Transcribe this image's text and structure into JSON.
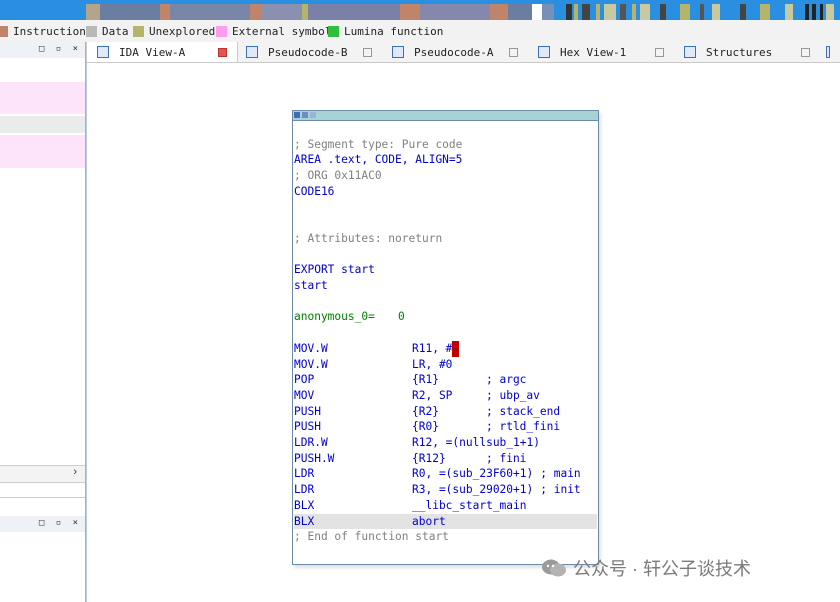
{
  "legend": {
    "items": [
      {
        "label": "Instruction",
        "color": "#c0846a"
      },
      {
        "label": "Data",
        "color": "#b9b9b9"
      },
      {
        "label": "Unexplored",
        "color": "#b4b46a"
      },
      {
        "label": "External symbol",
        "color": "#ff9cf0"
      },
      {
        "label": "Lumina function",
        "color": "#2fbf3a"
      }
    ]
  },
  "left_panel": {
    "header_buttons": "□ ▫ ×",
    "scroll_arrow": "›",
    "second_header_buttons": "□ ▫ ×"
  },
  "tabs": [
    {
      "label": "IDA View-A",
      "active": true
    },
    {
      "label": "Pseudocode-B",
      "active": false
    },
    {
      "label": "Pseudocode-A",
      "active": false
    },
    {
      "label": "Hex View-1",
      "active": false
    },
    {
      "label": "Structures",
      "active": false
    }
  ],
  "code": [
    {
      "a": "",
      "b": "",
      "kind": "blank"
    },
    {
      "a": "; Segment type: Pure code",
      "b": "",
      "kind": "comment"
    },
    {
      "a": "AREA .text, CODE, ALIGN=5",
      "b": "",
      "kind": "blue"
    },
    {
      "a": "; ORG 0x11AC0",
      "b": "",
      "kind": "comment"
    },
    {
      "a": "CODE16",
      "b": "",
      "kind": "blue"
    },
    {
      "a": "",
      "b": "",
      "kind": "blank"
    },
    {
      "a": "",
      "b": "",
      "kind": "blank"
    },
    {
      "a": "; Attributes: noreturn",
      "b": "",
      "kind": "comment"
    },
    {
      "a": "",
      "b": "",
      "kind": "blank"
    },
    {
      "a": "EXPORT start",
      "b": "",
      "kind": "blue"
    },
    {
      "a": "start",
      "b": "",
      "kind": "blue"
    },
    {
      "a": "",
      "b": "",
      "kind": "blank"
    },
    {
      "a": "anonymous_0=",
      "b": "0",
      "kind": "green"
    },
    {
      "a": "",
      "b": "",
      "kind": "blank"
    },
    {
      "a": "MOV.W",
      "b": "R11, #",
      "c": "0",
      "kind": "instr-cursor"
    },
    {
      "a": "MOV.W",
      "b": "LR, #0",
      "kind": "instr"
    },
    {
      "a": "POP",
      "b": "{R1}",
      "cm": "; argc",
      "kind": "instr"
    },
    {
      "a": "MOV",
      "b": "R2, SP",
      "cm": "; ubp_av",
      "kind": "instr"
    },
    {
      "a": "PUSH",
      "b": "{R2}",
      "cm": "; stack_end",
      "kind": "instr"
    },
    {
      "a": "PUSH",
      "b": "{R0}",
      "cm": "; rtld_fini",
      "kind": "instr"
    },
    {
      "a": "LDR.W",
      "b": "R12, =(nullsub_1+1)",
      "kind": "instr"
    },
    {
      "a": "PUSH.W",
      "b": "{R12}",
      "cm": "; fini",
      "kind": "instr"
    },
    {
      "a": "LDR",
      "b": "R0, =(sub_23F60+1)",
      "cm": "; main",
      "kind": "instr"
    },
    {
      "a": "LDR",
      "b": "R3, =(sub_29020+1)",
      "cm": "; init",
      "kind": "instr"
    },
    {
      "a": "BLX",
      "b": "__libc_start_main",
      "kind": "instr"
    },
    {
      "a": "BLX",
      "b": "abort",
      "kind": "instr-hl"
    },
    {
      "a": "; End of function start",
      "b": "",
      "kind": "comment"
    }
  ],
  "watermark": {
    "text": "公众号 · 轩公子谈技术"
  }
}
